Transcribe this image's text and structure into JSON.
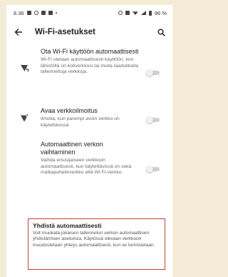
{
  "status_bar": {
    "time": "8.36",
    "battery": "96 %"
  },
  "app_bar": {
    "back_icon": "arrow-left-icon",
    "title": "Wi-Fi-asetukset",
    "search_icon": "search-icon"
  },
  "settings": [
    {
      "icon": "wifi-auto-icon",
      "title": "Ota Wi-Fi käyttöön automaattisesti",
      "description": "Wi-Fi otetaan automaattisesti käyttöön, kun lähistöllä on kotiverkkosi tai muita laadukkaita tallennettuja verkkoja.",
      "enabled": false
    },
    {
      "icon": "wifi-notification-icon",
      "title": "Avaa verkkoilmoitus",
      "description": "Ilmoita, kun parempi avoin verkko on käytettävissä",
      "enabled": false
    },
    {
      "icon": "",
      "title": "Automaattinen verkon vaihtaminen",
      "description": "Vaihda ensisijaiseen verkkoon automaattisesti, kun käytettävissä on sekä matkapuhelinverkko että Wi-Fi-verkko",
      "enabled": false
    }
  ],
  "callout": {
    "title": "Yhdistä automaattisesti",
    "text": "Voit muokata jokaisen tallennetun verkon automaattisen yhdistämisen asetuksia. Käytössä olevaan verkkoon muodostetaan yhteys automaattisesti, kun se tunnistetaan.",
    "border_color": "#cc3b2e"
  }
}
